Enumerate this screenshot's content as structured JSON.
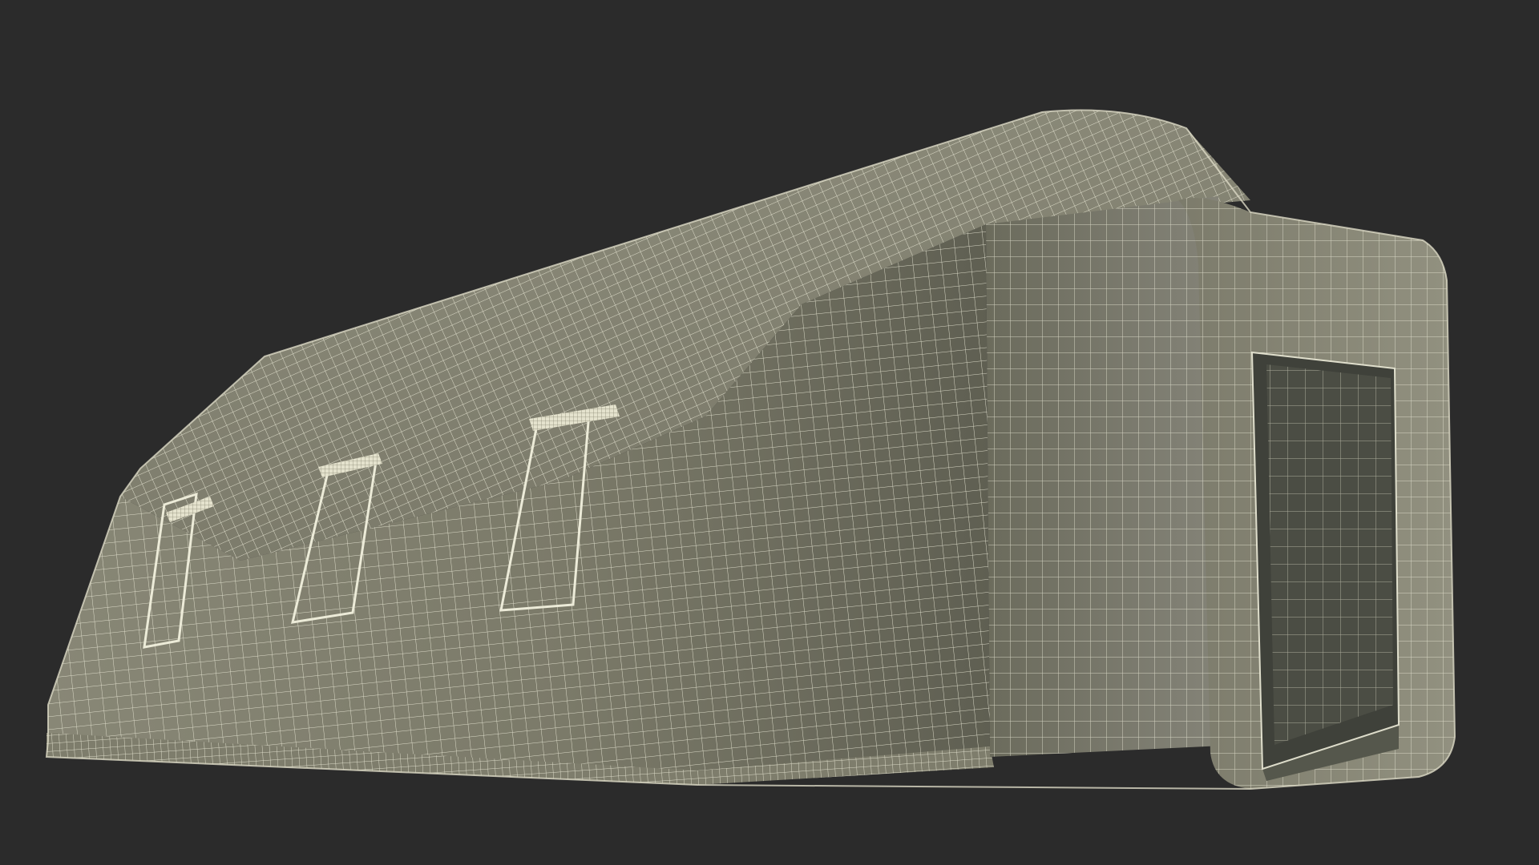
{
  "scene": {
    "subject": "inflatable-tent-wireframe",
    "render_style": "wireframe-over-clay",
    "colors": {
      "background": "#2b2b2b",
      "shell_light": "#8e8d7c",
      "shell_mid": "#7d7c6b",
      "shell_dark": "#5f5f52",
      "wire": "#ecebd8",
      "doorway_inner": "#3f413a",
      "doorway_floor": "#55574c"
    },
    "windows": 3,
    "rolled_flaps": 3,
    "doorways": 1
  }
}
